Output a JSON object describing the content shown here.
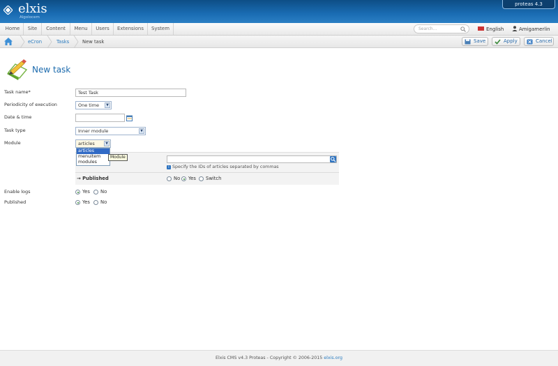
{
  "brand": {
    "name": "elxis",
    "tagline": "Algolocem",
    "version": "proteas 4.3"
  },
  "menu": [
    "Home",
    "Site",
    "Content",
    "Menu",
    "Users",
    "Extensions",
    "System"
  ],
  "search": {
    "placeholder": "Search..."
  },
  "language": "English",
  "user": "Amigamerlin",
  "breadcrumb": {
    "items": [
      "eCron",
      "Tasks"
    ],
    "current": "New task"
  },
  "toolbar": {
    "save": "Save",
    "apply": "Apply",
    "cancel": "Cancel"
  },
  "page_title": "New task",
  "form": {
    "task_name": {
      "label": "Task name*",
      "value": "Test Task"
    },
    "periodicity": {
      "label": "Periodicity of execution",
      "value": "One time"
    },
    "datetime": {
      "label": "Date & time",
      "value": ""
    },
    "task_type": {
      "label": "Task type",
      "value": "Inner module"
    },
    "module": {
      "label": "Module",
      "value": "articles",
      "options": [
        "articles",
        "menuitem",
        "modules"
      ],
      "tooltip": "Module"
    },
    "ids_hint": "Specify the IDs of articles separated by commas",
    "published_inner": {
      "label": "Published",
      "options": [
        "No",
        "Yes",
        "Switch"
      ],
      "selected": "Yes"
    },
    "enable_logs": {
      "label": "Enable logs",
      "options": [
        "Yes",
        "No"
      ],
      "selected": "Yes"
    },
    "published": {
      "label": "Published",
      "options": [
        "Yes",
        "No"
      ],
      "selected": "Yes"
    }
  },
  "footer": {
    "text": "Elxis CMS v4.3 Proteas - Copyright © 2006-2015",
    "link": "elxis.org"
  }
}
